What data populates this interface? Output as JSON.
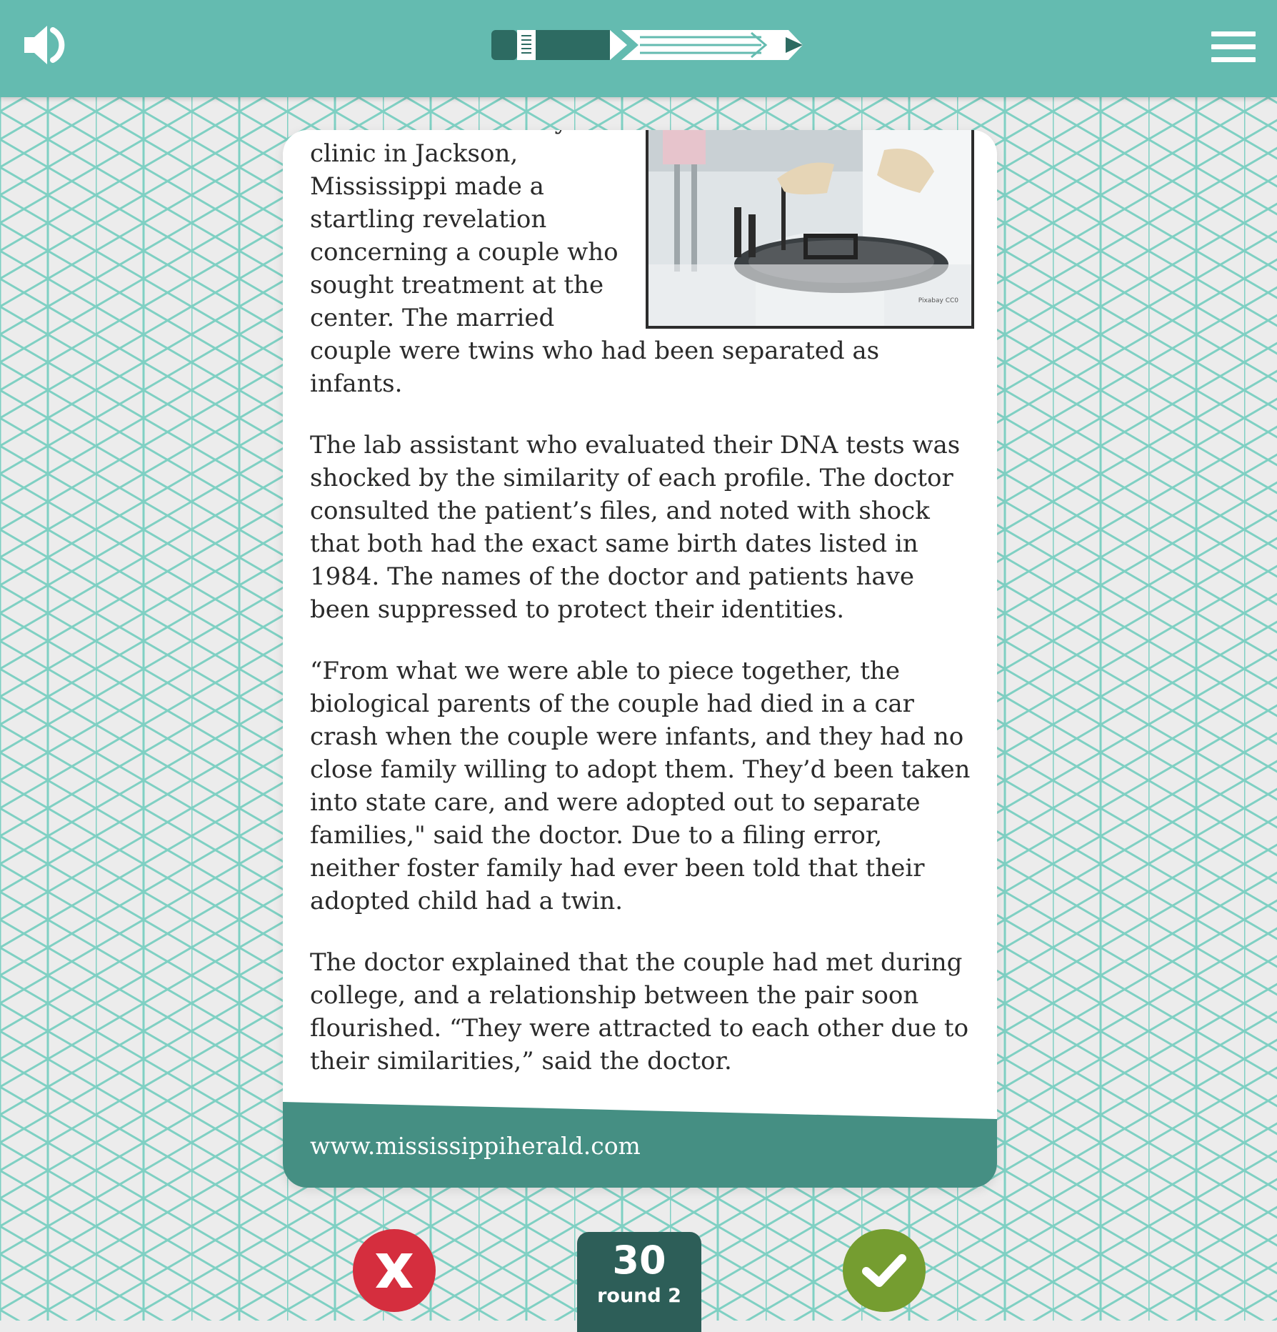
{
  "article": {
    "paragraphs": [
      "A doctor at a fertility clinic in Jackson, Mississippi made a startling revelation concerning a couple who sought treatment at the center. The married couple were twins who had been separated as infants.",
      "The lab assistant who evaluated their DNA tests was shocked by the similarity of each profile. The doctor consulted the patient’s files, and noted with shock that both had the exact same birth dates listed in 1984. The names of the doctor and patients have been suppressed to protect their identities.",
      "“From what we were able to piece together, the biological parents of the couple had died in a car crash when the couple were infants, and they had no close family willing to adopt them. They’d been taken into state care, and were adopted out to separate families,\" said the doctor. Due to a filing error, neither foster family had ever been told that their adopted child had a twin.",
      "The doctor explained that the couple had met during college, and a relationship between the pair soon flourished. “They were attracted to each other due to their similarities,” said the doctor."
    ],
    "photo_credit": "Pixabay CC0"
  },
  "footer": {
    "source_url": "www.mississippiherald.com"
  },
  "score": {
    "value": "30",
    "round_label": "round 2"
  },
  "icons": {
    "sound": "speaker-icon",
    "logo": "pencil-icon",
    "menu": "hamburger-menu-icon",
    "reject": "x-icon",
    "accept": "checkmark-icon"
  },
  "colors": {
    "topbar": "#64bbb0",
    "pattern_line": "#7fd0c3",
    "footer": "#458f83",
    "score_box": "#2d5e58",
    "reject": "#d52e3e",
    "accept": "#759d30"
  }
}
